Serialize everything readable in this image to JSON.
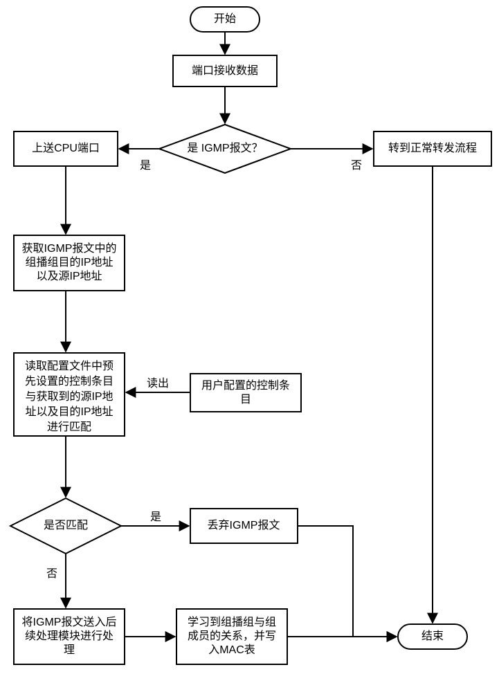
{
  "chart_data": {
    "type": "flowchart",
    "nodes": {
      "start": {
        "shape": "terminator",
        "label": "开始"
      },
      "recv": {
        "shape": "process",
        "label": "端口接收数据"
      },
      "isIGMP": {
        "shape": "decision",
        "label": "是 IGMP报文？"
      },
      "toCPU": {
        "shape": "process",
        "label": "上送CPU端口"
      },
      "normal": {
        "shape": "process",
        "label": "转到正常转发流程"
      },
      "getIP": {
        "shape": "process",
        "label": "获取IGMP报文中的\n组播组目的IP地址\n以及源IP地址"
      },
      "readCfg": {
        "shape": "process",
        "label": "读取配置文件中预\n先设置的控制条目\n与获取到的源IP地\n址以及目的IP地址\n进行匹配"
      },
      "userCfg": {
        "shape": "process",
        "label": "用户配置的控制条\n目"
      },
      "match": {
        "shape": "decision",
        "label": "是否匹配"
      },
      "discard": {
        "shape": "process",
        "label": "丢弃IGMP报文"
      },
      "postProc": {
        "shape": "process",
        "label": "将IGMP报文送入后\n续处理模块进行处\n理"
      },
      "learn": {
        "shape": "process",
        "label": "学习到组播组与组\n成员的关系，并写\n入MAC表"
      },
      "end": {
        "shape": "terminator",
        "label": "结束"
      }
    },
    "edges": [
      {
        "from": "start",
        "to": "recv"
      },
      {
        "from": "recv",
        "to": "isIGMP"
      },
      {
        "from": "isIGMP",
        "to": "toCPU",
        "label": "是"
      },
      {
        "from": "isIGMP",
        "to": "normal",
        "label": "否"
      },
      {
        "from": "toCPU",
        "to": "getIP"
      },
      {
        "from": "getIP",
        "to": "readCfg"
      },
      {
        "from": "userCfg",
        "to": "readCfg",
        "label": "读出"
      },
      {
        "from": "readCfg",
        "to": "match"
      },
      {
        "from": "match",
        "to": "discard",
        "label": "是"
      },
      {
        "from": "match",
        "to": "postProc",
        "label": "否"
      },
      {
        "from": "postProc",
        "to": "learn"
      },
      {
        "from": "discard",
        "to": "end"
      },
      {
        "from": "normal",
        "to": "end"
      },
      {
        "from": "learn",
        "to": "end"
      }
    ]
  },
  "labels": {
    "start": "开始",
    "recv": "端口接收数据",
    "isIGMP": "是 IGMP报文？",
    "toCPU": "上送CPU端口",
    "normal": "转到正常转发流程",
    "getIP_l1": "获取IGMP报文中的",
    "getIP_l2": "组播组目的IP地址",
    "getIP_l3": "以及源IP地址",
    "readCfg_l1": "读取配置文件中预",
    "readCfg_l2": "先设置的控制条目",
    "readCfg_l3": "与获取到的源IP地",
    "readCfg_l4": "址以及目的IP地址",
    "readCfg_l5": "进行匹配",
    "userCfg_l1": "用户配置的控制条",
    "userCfg_l2": "目",
    "match": "是否匹配",
    "discard": "丢弃IGMP报文",
    "postProc_l1": "将IGMP报文送入后",
    "postProc_l2": "续处理模块进行处",
    "postProc_l3": "理",
    "learn_l1": "学习到组播组与组",
    "learn_l2": "成员的关系，并写",
    "learn_l3": "入MAC表",
    "end": "结束",
    "yes": "是",
    "no": "否",
    "readout": "读出"
  }
}
